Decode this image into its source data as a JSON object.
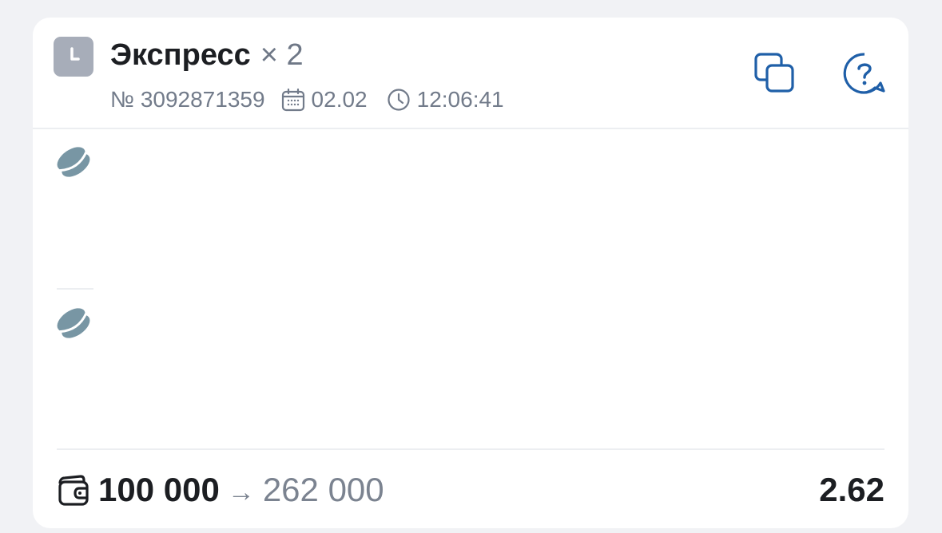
{
  "bet": {
    "type": "Экспресс",
    "multiplier": "× 2",
    "number": "№ 3092871359",
    "date": "02.02",
    "time": "12:06:41"
  },
  "footer": {
    "stake": "100 000",
    "arrow": "→",
    "potential_win": "262 000",
    "odds": "2.62"
  },
  "icons": {
    "status": "clock-icon",
    "date": "calendar-icon",
    "time": "clock-icon",
    "copy": "copy-icon",
    "help": "help-chat-icon",
    "event": "hockey-puck-icon",
    "wallet": "wallet-icon"
  },
  "colors": {
    "accent": "#1f5fa8",
    "status_bg": "#a7adb9",
    "sport_icon": "#7896a4",
    "muted_text": "#727b8a"
  }
}
